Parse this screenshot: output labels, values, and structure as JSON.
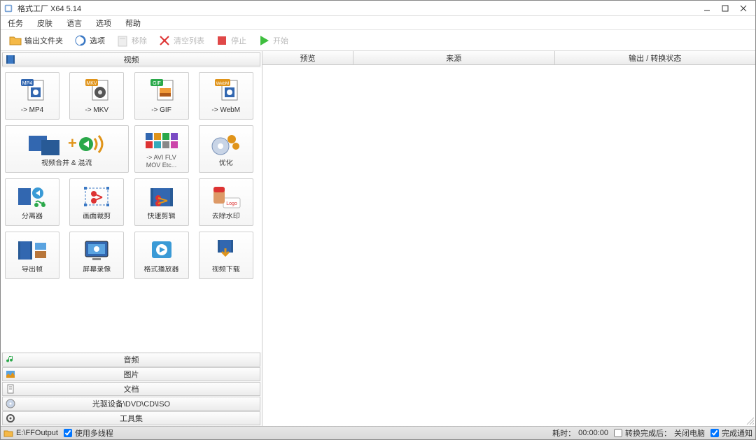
{
  "window": {
    "title": "格式工厂 X64 5.14"
  },
  "menu": {
    "task": "任务",
    "skin": "皮肤",
    "language": "语言",
    "options": "选项",
    "help": "帮助"
  },
  "toolbar": {
    "output_folder": "输出文件夹",
    "options": "选项",
    "remove": "移除",
    "clear_list": "清空列表",
    "stop": "停止",
    "start": "开始"
  },
  "categories": {
    "video": "视频",
    "audio": "音频",
    "picture": "图片",
    "document": "文档",
    "rom": "光驱设备\\DVD\\CD\\ISO",
    "toolset": "工具集"
  },
  "tiles": {
    "mp4": "-> MP4",
    "mkv": "-> MKV",
    "gif": "-> GIF",
    "webm": "-> WebM",
    "merge": "视频合并 & 混流",
    "avi_l1": "-> AVI FLV",
    "avi_l2": "MOV Etc...",
    "optimize": "优化",
    "splitter": "分离器",
    "crop": "画面裁剪",
    "quickcut": "快速剪辑",
    "watermark": "去除水印",
    "export_frame": "导出帧",
    "screenrec": "屏幕录像",
    "player": "格式播放器",
    "download": "视频下载"
  },
  "list_columns": {
    "preview": "预览",
    "source": "来源",
    "status": "输出 / 转换状态"
  },
  "status": {
    "output_path": "E:\\FFOutput",
    "multithread": "使用多线程",
    "elapsed_label": "耗时：",
    "elapsed_value": "00:00:00",
    "after_done_label": "转换完成后：",
    "after_done_value": "关闭电脑",
    "notify": "完成通知"
  }
}
